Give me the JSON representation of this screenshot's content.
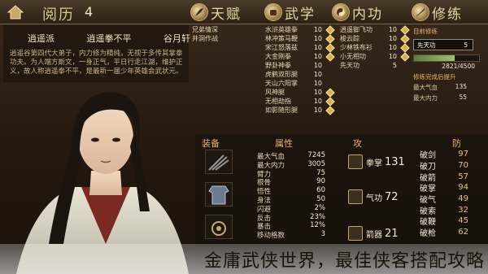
{
  "header": {
    "exp_label": "阅历",
    "exp_value": "4",
    "tabs": [
      {
        "label": "天赋",
        "icon": "feather-icon"
      },
      {
        "label": "武学",
        "icon": "fist-icon"
      },
      {
        "label": "内功",
        "icon": "yin-yang-icon"
      },
      {
        "label": "修练",
        "icon": "sword-icon"
      }
    ]
  },
  "bio": {
    "tags": [
      "逍遥派",
      "逍遥拳不平",
      "谷月轩"
    ],
    "text": "逍遥谷第四代大弟子，内力修为精纯，无视于多传其掌拳功夫。为人端方斯文，一身正气，平日行走江湖，维护正义，故人称逍遥拳不平，是最新一届少年英雄会武状元。"
  },
  "talents": [
    "兄弟情深",
    "井洞作战"
  ],
  "martial": [
    {
      "name": "水浒英雄拳",
      "level": "10",
      "mark": true
    },
    {
      "name": "林冲策马鞭",
      "level": "10",
      "mark": true
    },
    {
      "name": "宋江怒落兹",
      "level": "10",
      "mark": true
    },
    {
      "name": "大金刚拳",
      "level": "10",
      "mark": true
    },
    {
      "name": "野卦神拳",
      "level": "10",
      "mark": false
    },
    {
      "name": "虎鹤双形腿",
      "level": "10",
      "mark": false
    },
    {
      "name": "天山六阳掌",
      "level": "10",
      "mark": false
    },
    {
      "name": "风神腿",
      "level": "10",
      "mark": true
    },
    {
      "name": "无相劫指",
      "level": "10",
      "mark": true
    },
    {
      "name": "如影随形腿",
      "level": "10",
      "mark": true
    }
  ],
  "inner": [
    {
      "name": "逍遥御飞功",
      "level": "10",
      "mark": true
    },
    {
      "name": "梭云踪",
      "level": "10",
      "mark": true
    },
    {
      "name": "少林铁布衫",
      "level": "10",
      "mark": true
    },
    {
      "name": "小无相功",
      "level": "10",
      "mark": true
    },
    {
      "name": "先天功",
      "level": "5",
      "mark": false
    }
  ],
  "practice": {
    "current_label": "目前修练",
    "current_skill": "先天功",
    "current_level": "5",
    "progress_text": "2821/4500",
    "progress": 0.627,
    "complete_label": "修练完成后提升",
    "bonuses": [
      {
        "k": "最大气血",
        "v": "135"
      },
      {
        "k": "最大内力",
        "v": "55"
      }
    ]
  },
  "columns": {
    "equip": "装备",
    "attr": "属性",
    "atk": "攻",
    "def": "防"
  },
  "attributes": [
    {
      "k": "最大气血",
      "v": "7245"
    },
    {
      "k": "最大内力",
      "v": "3005"
    },
    {
      "k": "臂力",
      "v": "75"
    },
    {
      "k": "根骨",
      "v": "90"
    },
    {
      "k": "悟性",
      "v": "60"
    },
    {
      "k": "身法",
      "v": "50"
    },
    {
      "k": "闪避",
      "v": "2%"
    },
    {
      "k": "反击",
      "v": "23%"
    },
    {
      "k": "暴击",
      "v": "12%"
    },
    {
      "k": "移动格数",
      "v": "3"
    }
  ],
  "attacks": [
    {
      "name": "拳掌",
      "value": "131"
    },
    {
      "name": "气功",
      "value": "72"
    },
    {
      "name": "箭器",
      "value": "21"
    }
  ],
  "defenses": [
    {
      "k": "破剑",
      "v": "97"
    },
    {
      "k": "破刀",
      "v": "70"
    },
    {
      "k": "破箭",
      "v": "57"
    },
    {
      "k": "破掌",
      "v": "94"
    },
    {
      "k": "破气",
      "v": "49"
    },
    {
      "k": "破索",
      "v": "32"
    },
    {
      "k": "破鞭",
      "v": "45"
    },
    {
      "k": "破枪",
      "v": "62"
    }
  ],
  "caption": "金庸武侠世界，最佳侠客搭配攻略"
}
